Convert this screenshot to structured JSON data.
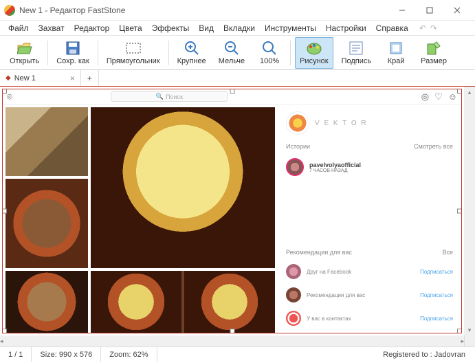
{
  "title": "New 1 - Редактор FastStone",
  "menus": [
    "Файл",
    "Захват",
    "Редактор",
    "Цвета",
    "Эффекты",
    "Вид",
    "Вкладки",
    "Инструменты",
    "Настройки",
    "Справка"
  ],
  "toolbar": {
    "open": "Открыть",
    "save_as": "Сохр. как",
    "rect": "Прямоугольник",
    "zoom_in": "Крупнее",
    "zoom_out": "Мельче",
    "zoom_100": "100%",
    "draw": "Рисунок",
    "caption": "Подпись",
    "edge": "Край",
    "resize": "Размер"
  },
  "tab": {
    "name": "New 1"
  },
  "instagram": {
    "search_placeholder": "Поиск",
    "user_name": "V E K T O R",
    "stories_header": "Истории",
    "see_all": "Смотреть все",
    "story_user": "pavelvolyaofficial",
    "story_time": "7 ЧАСОВ НАЗАД",
    "recs_header": "Рекомендации для вас",
    "recs_all": "Все",
    "recs": [
      {
        "text": "Друг на Facebook",
        "action": "Подписаться"
      },
      {
        "text": "Рекомендации для вас",
        "action": "Подписаться"
      },
      {
        "text": "У вас в контактах",
        "action": "Подписаться"
      }
    ]
  },
  "status": {
    "page": "1 / 1",
    "size": "Size: 990 x 576",
    "zoom": "Zoom: 62%",
    "registered": "Registered to : Jadovran"
  }
}
